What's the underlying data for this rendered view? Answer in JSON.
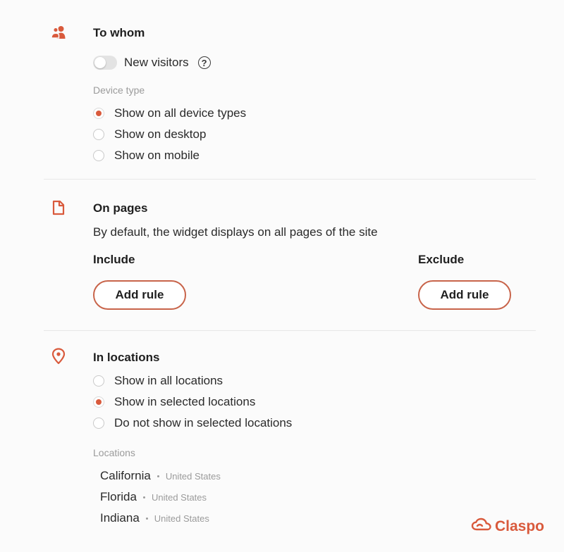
{
  "colors": {
    "accent": "#d95a3c",
    "accent_border": "#c8644a",
    "muted_text": "#9b9b9b",
    "divider": "#e7e7e7"
  },
  "to_whom": {
    "icon": "users-icon",
    "title": "To whom",
    "toggle_label": "New visitors",
    "toggle_on": false,
    "help_icon_glyph": "?",
    "device_type_label": "Device type",
    "device_options": [
      {
        "label": "Show on all device types",
        "checked": true
      },
      {
        "label": "Show on desktop",
        "checked": false
      },
      {
        "label": "Show on mobile",
        "checked": false
      }
    ]
  },
  "on_pages": {
    "icon": "page-icon",
    "title": "On pages",
    "description": "By default, the widget displays on all pages of the site",
    "include_label": "Include",
    "exclude_label": "Exclude",
    "include_button": "Add rule",
    "exclude_button": "Add rule"
  },
  "in_locations": {
    "icon": "location-pin-icon",
    "title": "In locations",
    "location_options": [
      {
        "label": "Show in all locations",
        "checked": false
      },
      {
        "label": "Show in selected locations",
        "checked": true
      },
      {
        "label": "Do not show in selected locations",
        "checked": false
      }
    ],
    "locations_label": "Locations",
    "locations": [
      {
        "name": "California",
        "country": "United States"
      },
      {
        "name": "Florida",
        "country": "United States"
      },
      {
        "name": "Indiana",
        "country": "United States"
      }
    ]
  },
  "brand": {
    "name": "Claspo",
    "icon": "cloud-logo-icon"
  }
}
